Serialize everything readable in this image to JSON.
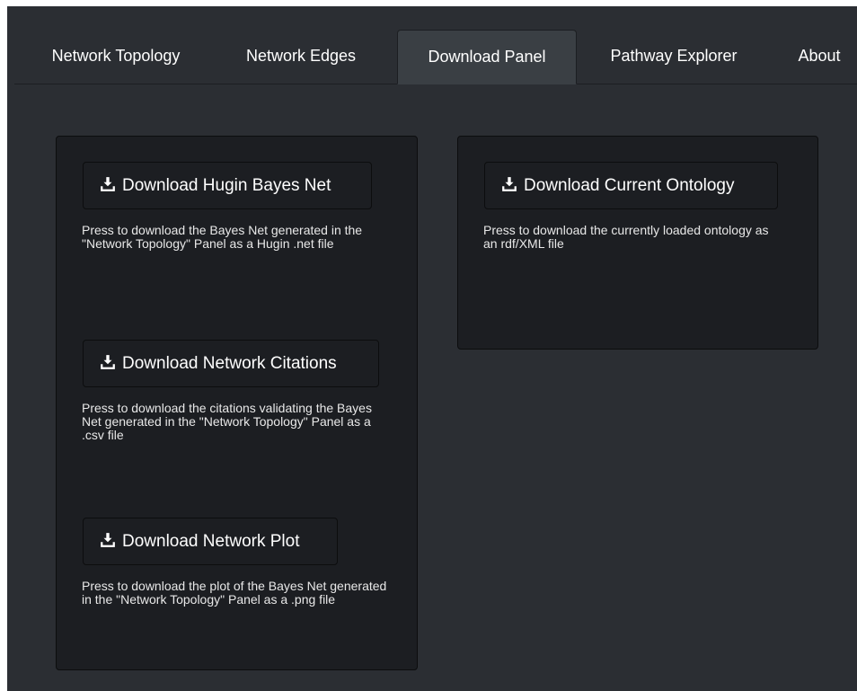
{
  "tabs": [
    {
      "label": "Network Topology"
    },
    {
      "label": "Network Edges"
    },
    {
      "label": "Download Panel"
    },
    {
      "label": "Pathway Explorer"
    },
    {
      "label": "About"
    }
  ],
  "active_tab": "Download Panel",
  "left_panel": {
    "items": [
      {
        "button_label": "Download Hugin Bayes Net",
        "description": "Press to download the Bayes Net generated in the \"Network Topology\" Panel as a Hugin .net file",
        "icon": "download-icon"
      },
      {
        "button_label": "Download Network Citations",
        "description": "Press to download the citations validating the Bayes Net generated in the \"Network Topology\" Panel as a .csv file",
        "icon": "download-icon"
      },
      {
        "button_label": "Download Network Plot",
        "description": "Press to download the plot of the Bayes Net generated in the \"Network Topology\" Panel as a .png file",
        "icon": "download-icon"
      }
    ]
  },
  "right_panel": {
    "items": [
      {
        "button_label": "Download Current Ontology",
        "description": "Press to download the currently loaded ontology as an rdf/XML file",
        "icon": "download-icon"
      }
    ]
  },
  "colors": {
    "page_background": "#2b2e33",
    "panel_background": "#1c1e22",
    "active_tab_background": "#3a3f44",
    "text": "#ffffff"
  }
}
